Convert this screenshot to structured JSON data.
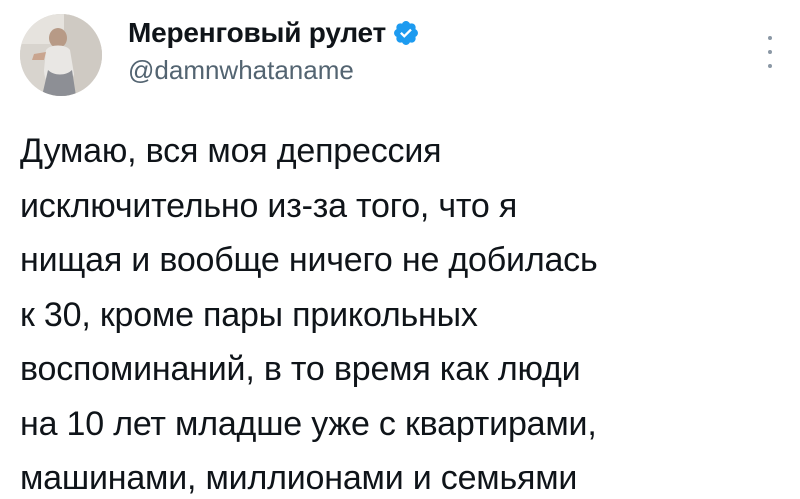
{
  "tweet": {
    "author": {
      "display_name": "Меренговый рулет",
      "handle": "@damnwhataname",
      "verified_icon": "verified-badge-icon",
      "avatar": "profile-photo"
    },
    "text": "Думаю, вся моя депрессия\nисключительно из-за того, что я\nнищая и вообще ничего не добилась\nк 30, кроме пары прикольных\nвоспоминаний, в то время как люди\nна 10 лет младше уже с квартирами,\nмашинами, миллионами и семьями",
    "more_icon": "more-options-icon"
  },
  "colors": {
    "text_primary": "#0f1419",
    "text_secondary": "#536471",
    "verified_blue": "#1d9bf0",
    "background": "#ffffff"
  }
}
